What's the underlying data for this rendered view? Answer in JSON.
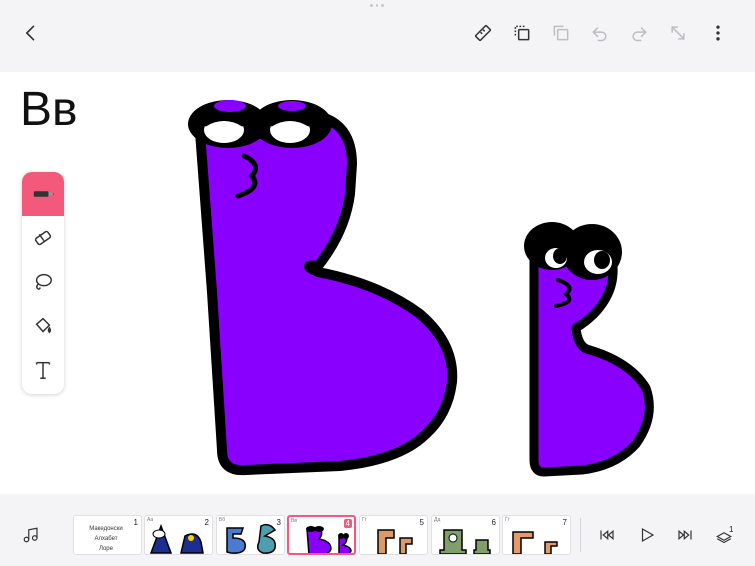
{
  "canvas": {
    "letter_title": "Вв"
  },
  "toolbar_icons": [
    "back-icon",
    "ruler-icon",
    "copy-layer-icon",
    "duplicate-icon",
    "undo-icon",
    "redo-icon",
    "expand-icon",
    "more-options-icon"
  ],
  "tools": [
    "pen-icon",
    "eraser-icon",
    "lasso-icon",
    "fill-bucket-icon",
    "text-icon"
  ],
  "frames": [
    {
      "number": "1",
      "tag": "",
      "cover_lines": [
        "Македонски",
        "Алхабет",
        "Лоре"
      ]
    },
    {
      "number": "2",
      "tag": "Аа"
    },
    {
      "number": "3",
      "tag": "Бб"
    },
    {
      "number": "4",
      "tag": "Вв"
    },
    {
      "number": "5",
      "tag": "Гг"
    },
    {
      "number": "6",
      "tag": "Дд"
    },
    {
      "number": "7",
      "tag": "Ѓѓ"
    }
  ],
  "playback": {
    "layer_count": "1"
  },
  "colors": {
    "accent": "#f2597a",
    "letter_fill": "#8a00ff",
    "outline": "#000000"
  }
}
